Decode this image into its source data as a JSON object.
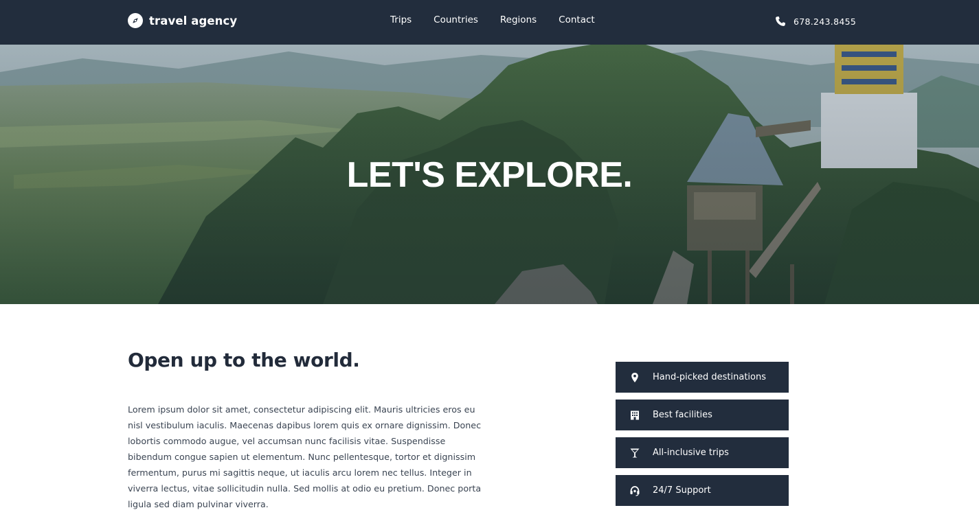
{
  "header": {
    "brand": "travel agency",
    "brand_icon": "compass-icon",
    "nav": [
      "Trips",
      "Countries",
      "Regions",
      "Contact"
    ],
    "phone": "678.243.8455",
    "phone_icon": "phone-icon",
    "background": "#222d3d"
  },
  "hero": {
    "title": "LET'S EXPLORE."
  },
  "main": {
    "heading": "Open up to the world.",
    "body": "Lorem ipsum dolor sit amet, consectetur adipiscing elit. Mauris ultricies eros eu nisl vestibulum iaculis. Maecenas dapibus lorem quis ex ornare dignissim. Donec lobortis commodo augue, vel accumsan nunc facilisis vitae. Suspendisse bibendum congue sapien ut elementum. Nunc pellentesque, tortor et dignissim fermentum, purus mi sagittis neque, ut iaculis arcu lorem nec tellus. Integer in viverra lectus, vitae sollicitudin nulla. Sed mollis at odio eu pretium. Donec porta ligula sed diam pulvinar viverra."
  },
  "features": [
    {
      "label": "Hand-picked destinations",
      "icon": "map-marker-icon"
    },
    {
      "label": "Best facilities",
      "icon": "building-icon"
    },
    {
      "label": "All-inclusive trips",
      "icon": "cocktail-glass-icon"
    },
    {
      "label": "24/7 Support",
      "icon": "headset-icon"
    }
  ],
  "colors": {
    "navy": "#222d3d",
    "text": "#222b3a",
    "white": "#ffffff"
  }
}
